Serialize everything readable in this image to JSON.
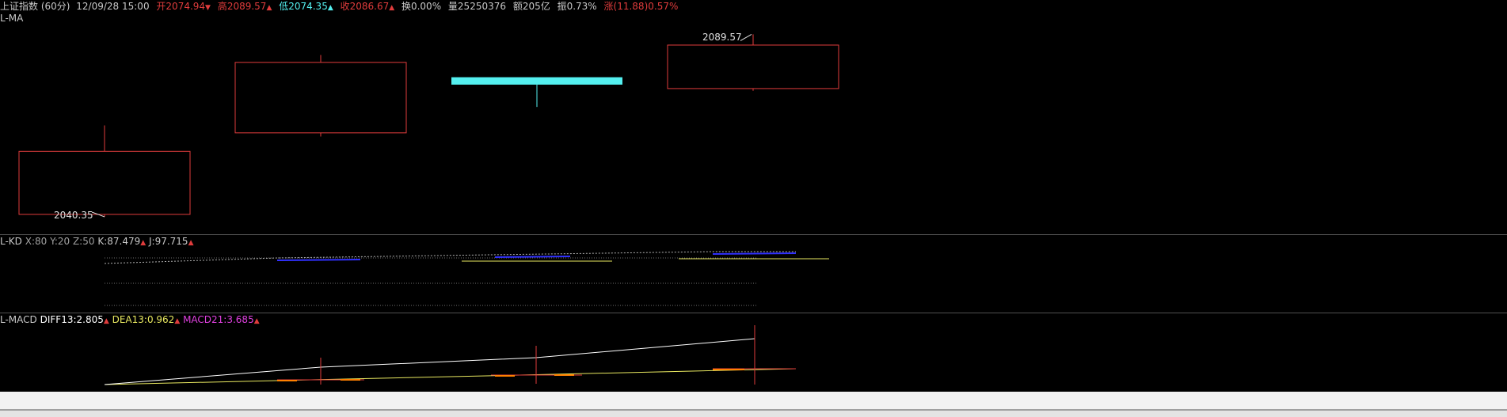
{
  "header": {
    "title": "上证指数 (60分)",
    "datetime": "12/09/28 15:00",
    "open_label": "开",
    "open_value": "2074.94",
    "high_label": "高",
    "high_value": "2089.57",
    "low_label": "低",
    "low_value": "2074.35",
    "close_label": "收",
    "close_value": "2086.67",
    "turnover": "换0.00%",
    "volume": "量25250376",
    "amount": "额205亿",
    "amplitude": "振0.73%",
    "change": "涨(11.88)0.57%"
  },
  "main_panel": {
    "indicator": "L-MA",
    "max_label": "2089.57",
    "min_label": "2040.35"
  },
  "kd_panel": {
    "name": "L-KD",
    "params": "X:80  Y:20  Z:50",
    "k_label": "K:87.479",
    "j_label": "J:97.715"
  },
  "macd_panel": {
    "name": "L-MACD",
    "diff_label": "DIFF13:2.805",
    "dea_label": "DEA13:0.962",
    "macd_label": "MACD21:3.685"
  },
  "colors": {
    "up": "#e03c3c",
    "down": "#54f0f0",
    "text": "#c8c8c8",
    "diff": "#ffffff",
    "dea": "#e8e860",
    "macd": "#e040e0",
    "k_line": "#3030ff"
  },
  "chart_data": {
    "type": "candlestick",
    "candles": [
      {
        "open": 2041,
        "close": 2058,
        "high": 2065,
        "low": 2040.35,
        "direction": "up"
      },
      {
        "open": 2063,
        "close": 2082,
        "high": 2084,
        "low": 2062,
        "direction": "up"
      },
      {
        "open": 2078,
        "close": 2076,
        "high": 2078,
        "low": 2070,
        "direction": "down"
      },
      {
        "open": 2074.94,
        "close": 2086.67,
        "high": 2089.57,
        "low": 2074.35,
        "direction": "up"
      }
    ],
    "ylim": [
      2038,
      2092
    ]
  }
}
